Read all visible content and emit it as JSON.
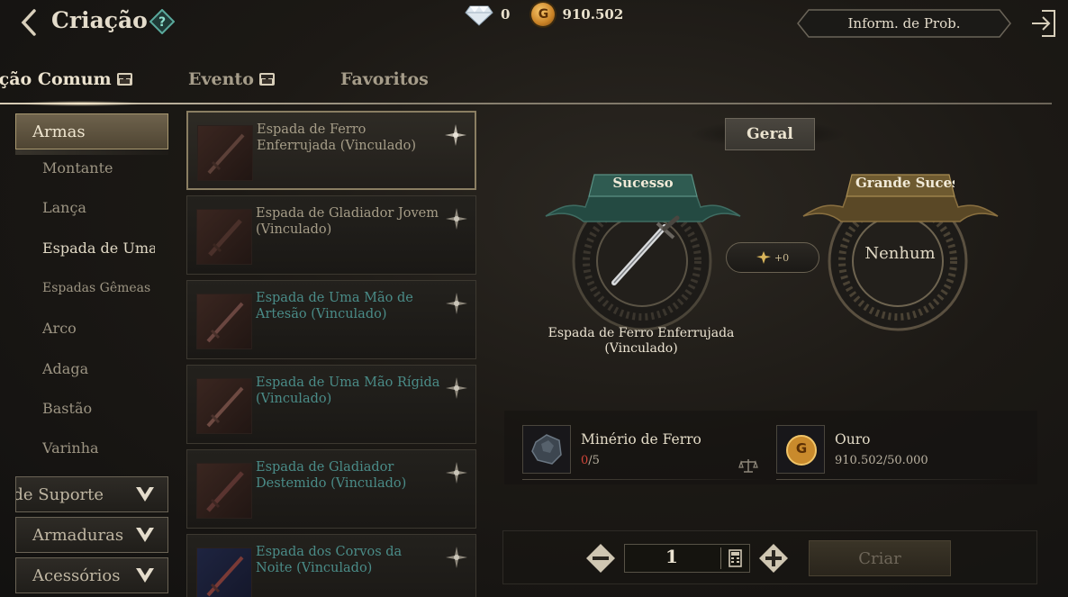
{
  "header": {
    "title": "Criação",
    "prob_button": "Inform. de Prob.",
    "currency": {
      "diamonds": "0",
      "gold": "910.502",
      "gold_symbol": "G"
    }
  },
  "tabs": [
    {
      "label": "Criação Comum",
      "active": true,
      "badge": true
    },
    {
      "label": "Evento",
      "active": false,
      "badge": true
    },
    {
      "label": "Favoritos",
      "active": false,
      "badge": false
    }
  ],
  "sidebar": {
    "weapons_header": "Armas",
    "sub_items": [
      "Montante",
      "Lança",
      "Espada de Uma Mão",
      "Espadas Gêmeas",
      "Arco",
      "Adaga",
      "Bastão",
      "Varinha"
    ],
    "selected_sub": "Espada de Uma Mão",
    "collapsed_headers": [
      "Armas de Suporte",
      "Armaduras",
      "Acessórios"
    ]
  },
  "items": [
    {
      "name": "Espada de Ferro Enferrujada (Vinculado)",
      "selected": true,
      "teal": false
    },
    {
      "name": "Espada de Gladiador Jovem (Vinculado)",
      "selected": false,
      "teal": false
    },
    {
      "name": "Espada de Uma Mão de Artesão (Vinculado)",
      "selected": false,
      "teal": true
    },
    {
      "name": "Espada de Uma Mão Rígida (Vinculado)",
      "selected": false,
      "teal": true
    },
    {
      "name": "Espada de Gladiador Destemido (Vinculado)",
      "selected": false,
      "teal": true
    },
    {
      "name": "Espada dos Corvos da Noite (Vinculado)",
      "selected": false,
      "teal": true
    }
  ],
  "craft": {
    "tab": "Geral",
    "success_label": "Sucesso",
    "great_success_label": "Grande Sucesso",
    "great_success_value": "Nenhum",
    "bonus": "+0",
    "success_item": "Espada de Ferro Enferrujada (Vinculado)",
    "materials": [
      {
        "name": "Minério de Ferro",
        "have": "0",
        "need": "/5"
      },
      {
        "name": "Ouro",
        "amount": "910.502/50.000"
      }
    ],
    "quantity": "1",
    "create_button": "Criar"
  },
  "colors": {
    "accent": "#8a7e62",
    "teal_text": "#4a8c88",
    "insufficient": "#d2463a",
    "ribbon_green": "#2e5a50",
    "ribbon_gold": "#7a6232"
  }
}
